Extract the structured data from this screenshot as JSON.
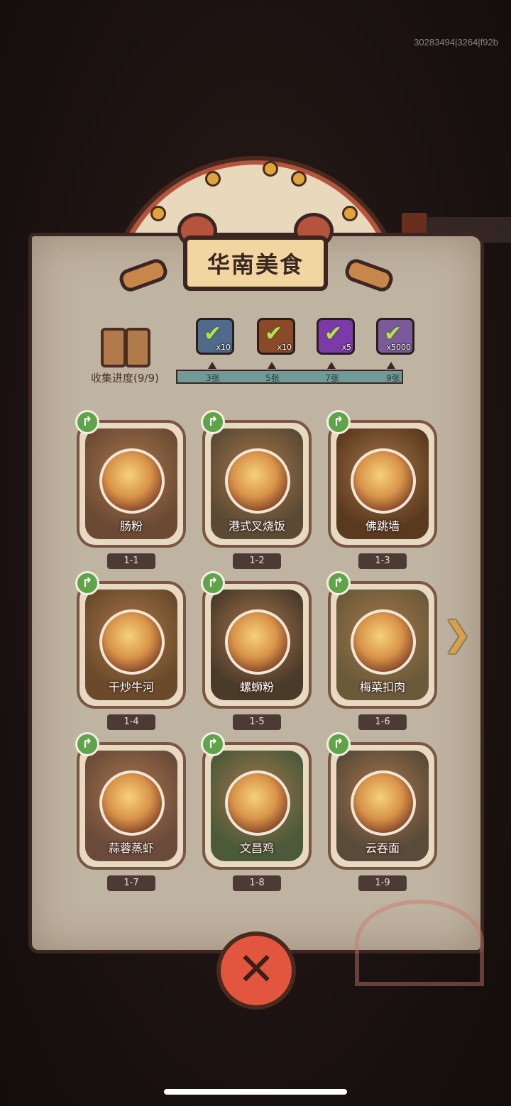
{
  "build_id": "30283494|3264|f92b",
  "panel": {
    "title": "华南美食"
  },
  "collection": {
    "label": "收集进度(9/9)",
    "rewards": [
      {
        "icon": "gem-chest-icon",
        "qty": "x10",
        "color": "#4f6a8a"
      },
      {
        "icon": "golden-key-icon",
        "qty": "x10",
        "color": "#8a4a2a"
      },
      {
        "icon": "purple-orb-icon",
        "qty": "x5",
        "color": "#7a3aa8"
      },
      {
        "icon": "silver-ingot-icon",
        "qty": "x5000",
        "color": "#7a5a9a"
      }
    ],
    "milestones": [
      "3张",
      "5张",
      "7张",
      "9张"
    ]
  },
  "dishes": [
    {
      "name": "肠粉",
      "id": "1-1",
      "color": "#6b4a34"
    },
    {
      "name": "港式叉烧饭",
      "id": "1-2",
      "color": "#5a4a34"
    },
    {
      "name": "佛跳墙",
      "id": "1-3",
      "color": "#5a3a1e"
    },
    {
      "name": "干炒牛河",
      "id": "1-4",
      "color": "#6a4a2a"
    },
    {
      "name": "螺蛳粉",
      "id": "1-5",
      "color": "#4a3a2a"
    },
    {
      "name": "梅菜扣肉",
      "id": "1-6",
      "color": "#6a5a3a"
    },
    {
      "name": "蒜蓉蒸虾",
      "id": "1-7",
      "color": "#6a4a3a"
    },
    {
      "name": "文昌鸡",
      "id": "1-8",
      "color": "#4a5a3a"
    },
    {
      "name": "云吞面",
      "id": "1-9",
      "color": "#5a4a3a"
    }
  ],
  "icons": {
    "share": "share-arrow-icon",
    "next": "next-page-arrow-icon",
    "close": "close-icon"
  }
}
